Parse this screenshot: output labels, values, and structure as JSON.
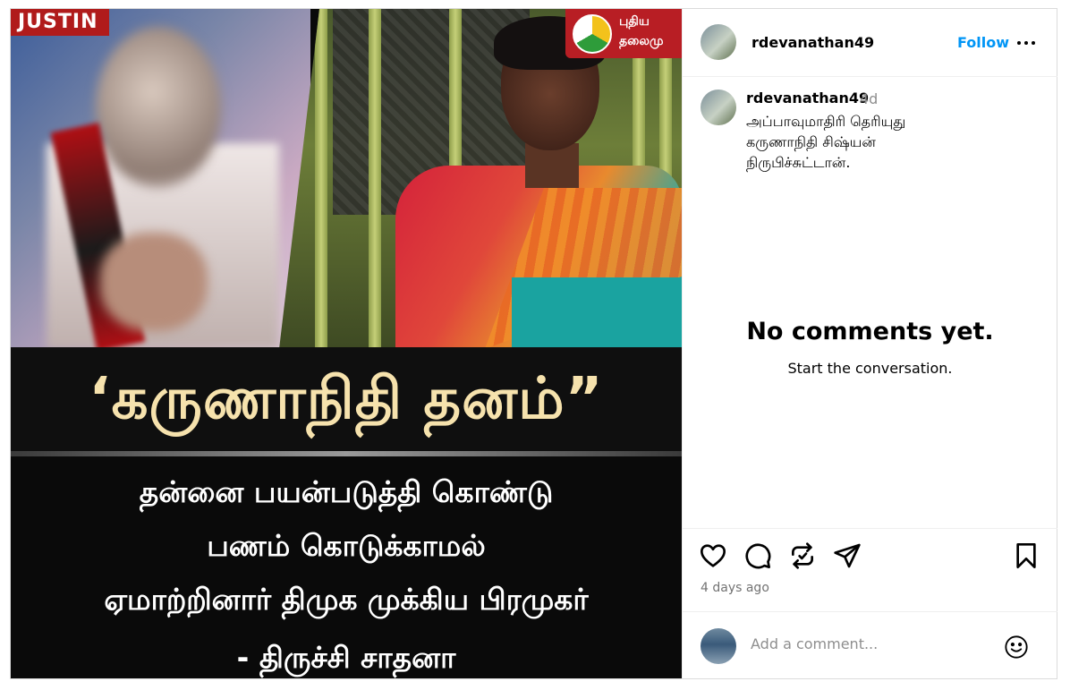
{
  "media": {
    "badge": "JUSTIN",
    "channel_line1": "புதிய",
    "channel_line2": "தலைமு",
    "headline": "‘கருணாநிதி தனம்”",
    "sub1": "தன்னை பயன்படுத்தி கொண்டு",
    "sub2": "பணம் கொடுக்காமல்",
    "sub3": "ஏமாற்றினார் திமுக முக்கிய பிரமுகர்",
    "sub4": "-   திருச்சி சாதனா"
  },
  "header": {
    "username": "rdevanathan49",
    "follow_label": "Follow",
    "more_icon": "more-horizontal-icon"
  },
  "caption": {
    "username": "rdevanathan49",
    "time": "4d",
    "line1": "அப்பாவுமாதிரி தெரியுது",
    "line2": "கருணாநிதி சிஷ்யன்",
    "line3": "நிருபிச்சுட்டான்."
  },
  "comments": {
    "empty_title": "No comments yet.",
    "empty_subtitle": "Start the conversation."
  },
  "actions": {
    "icons": [
      "heart-icon",
      "comment-icon",
      "repost-icon",
      "share-icon",
      "bookmark-icon"
    ],
    "timestamp": "4 days ago"
  },
  "add_comment": {
    "placeholder": "Add a comment...",
    "emoji_icon": "emoji-icon"
  },
  "colors": {
    "follow": "#0095f6",
    "muted": "#8e8e8e",
    "border": "#dbdbdb"
  }
}
